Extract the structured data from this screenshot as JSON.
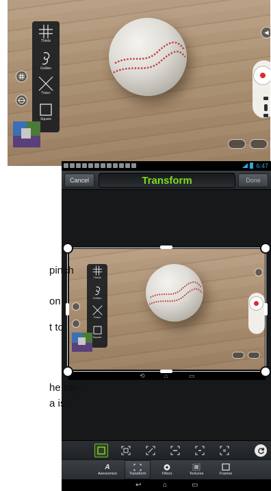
{
  "camera_screenshot": {
    "composition_guides": [
      {
        "label": "Thirds",
        "icon": "thirds-grid-icon"
      },
      {
        "label": "Golden",
        "icon": "golden-spiral-icon"
      },
      {
        "label": "Trisec",
        "icon": "trisec-icon"
      },
      {
        "label": "Square",
        "icon": "square-icon"
      }
    ]
  },
  "editor": {
    "status_bar": {
      "time": "6:47"
    },
    "action_bar": {
      "cancel_label": "Cancel",
      "title": "Transform",
      "done_label": "Done"
    },
    "inner_guides": [
      {
        "label": "Thirds"
      },
      {
        "label": "Golden"
      },
      {
        "label": "Trisec"
      },
      {
        "label": "Square"
      }
    ],
    "tools": [
      "crop-free-icon",
      "crop-fit-icon",
      "crop-rotate-icon",
      "crop-8x10-icon",
      "crop-4x6-icon",
      "crop-5x7-icon",
      "rotate-icon"
    ],
    "tabs": [
      {
        "label": "Awesomize",
        "icon": "awesomize-icon"
      },
      {
        "label": "Transform",
        "icon": "transform-icon"
      },
      {
        "label": "Filters",
        "icon": "filters-icon"
      },
      {
        "label": "Textures",
        "icon": "textures-icon"
      },
      {
        "label": "Frames",
        "icon": "frames-icon"
      }
    ],
    "selected_tab": "Transform"
  },
  "side_text": {
    "line1": "pinch",
    "line2": "on",
    "line3": "t to",
    "line4": "he tap-",
    "line5": "a is"
  },
  "colors": {
    "title_green": "#7ddc1f",
    "status_blue": "#2ba8e0",
    "shutter_red": "#e4282a"
  }
}
